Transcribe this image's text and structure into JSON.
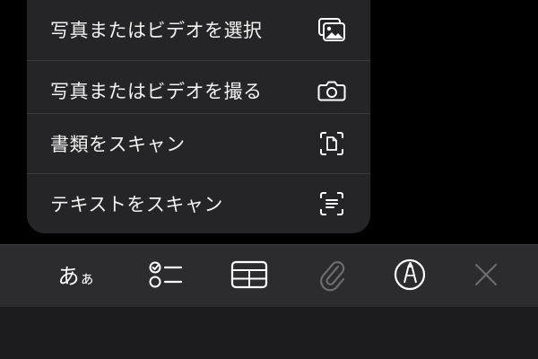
{
  "menu": {
    "items": [
      {
        "label": "写真またはビデオを選択",
        "icon": "photo-library-icon"
      },
      {
        "label": "写真またはビデオを撮る",
        "icon": "camera-icon"
      },
      {
        "label": "書類をスキャン",
        "icon": "document-scan-icon"
      },
      {
        "label": "テキストをスキャン",
        "icon": "text-scan-icon"
      }
    ]
  },
  "toolbar": {
    "format_label_large": "あ",
    "format_label_small": "ぁ",
    "tools": [
      "format-text-icon",
      "checklist-icon",
      "table-icon",
      "paperclip-icon",
      "markup-pen-icon",
      "close-icon"
    ]
  },
  "colors": {
    "background": "#000000",
    "menu_background": "#252527",
    "toolbar_background": "#2c2c2e",
    "text": "#f2f2f2",
    "icon_active": "#ffffff",
    "icon_disabled": "#6b6b70"
  }
}
